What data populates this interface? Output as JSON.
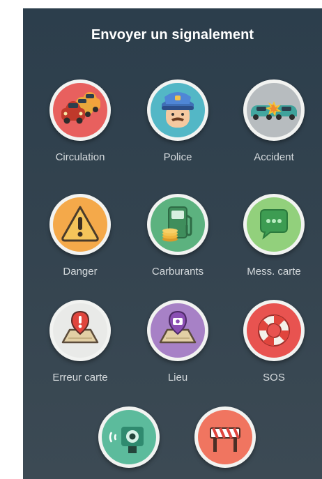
{
  "header": {
    "title": "Envoyer un signalement"
  },
  "reports": [
    {
      "label": "Circulation",
      "icon": "traffic-jam-icon",
      "color": "#e85c5c"
    },
    {
      "label": "Police",
      "icon": "police-officer-icon",
      "color": "#4fb6c6"
    },
    {
      "label": "Accident",
      "icon": "car-crash-icon",
      "color": "#b2b8bc"
    },
    {
      "label": "Danger",
      "icon": "warning-triangle-icon",
      "color": "#f3a646"
    },
    {
      "label": "Carburants",
      "icon": "fuel-pump-icon",
      "color": "#5bb07e"
    },
    {
      "label": "Mess. carte",
      "icon": "chat-bubble-icon",
      "color": "#8fcf7a"
    },
    {
      "label": "Erreur carte",
      "icon": "map-error-icon",
      "color": "#e6e8e6"
    },
    {
      "label": "Lieu",
      "icon": "place-camera-icon",
      "color": "#a47fc3"
    },
    {
      "label": "SOS",
      "icon": "lifebuoy-icon",
      "color": "#e8504e"
    },
    {
      "label": "",
      "icon": "speed-camera-icon",
      "color": "#58b99b"
    },
    {
      "label": "",
      "icon": "road-closure-icon",
      "color": "#ef6f5d"
    }
  ]
}
